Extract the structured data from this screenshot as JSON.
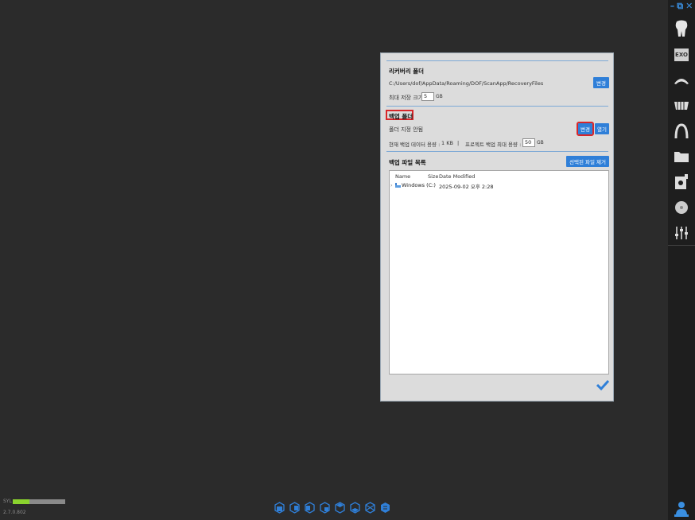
{
  "window_controls": {
    "minimize": "–",
    "restore": "⧉",
    "close": "✕"
  },
  "toolbar": {
    "exo_label": "EXO"
  },
  "dialog": {
    "recovery": {
      "title": "리커버리 폴더",
      "path": "C:/Users/dof/AppData/Roaming/DOF/ScanApp/RecoveryFiles",
      "change_label": "변경",
      "max_size_label": "최대 저장 크기",
      "max_size_value": "5",
      "max_size_unit": "GB"
    },
    "backup": {
      "title": "백업 폴더",
      "status": "폴더 지정 안됨",
      "change_label": "변경",
      "open_label": "열기",
      "current_label": "현재 백업 데이터 용량 :",
      "current_value": "1 KB",
      "separator": "|",
      "max_label": "프로젝트 백업 최대 용량 :",
      "max_value": "50",
      "max_unit": "GB"
    },
    "files": {
      "title": "백업 파일 목록",
      "remove_label": "선택된 파일 제거",
      "columns": {
        "name": "Name",
        "size": "Size",
        "date": "Date Modified"
      },
      "rows": [
        {
          "expander": "›",
          "name": "Windows (C:)",
          "size": "",
          "date": "2025-09-02 오후 2:28"
        }
      ]
    }
  },
  "status": {
    "syl_label": "SYL",
    "progress": 0.32,
    "version": "2.7.0.802"
  },
  "colors": {
    "accent": "#2f7fd8",
    "highlight": "#d8262a",
    "progress": "#8bd32e"
  }
}
